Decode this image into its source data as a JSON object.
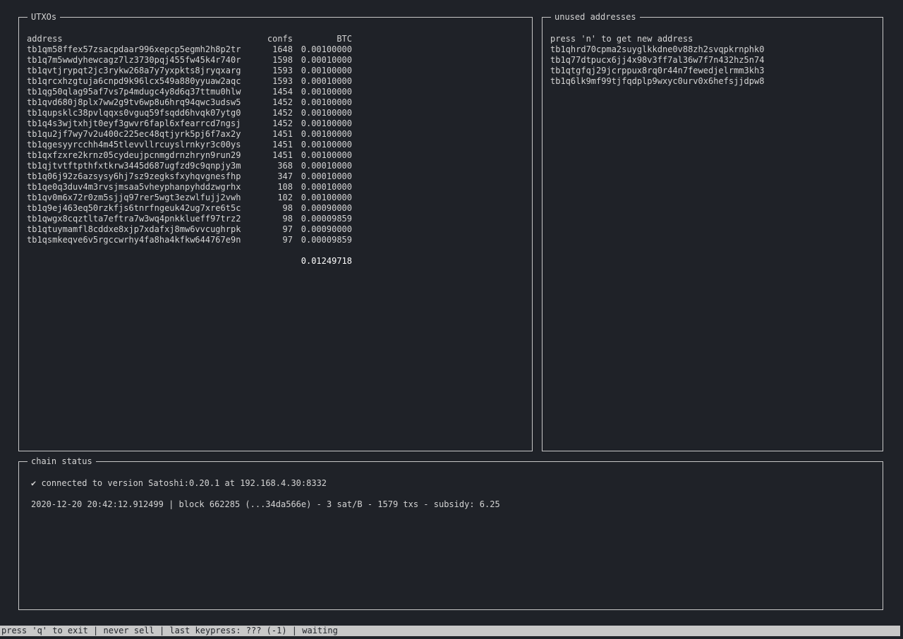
{
  "utxos": {
    "title": "UTXOs",
    "headers": {
      "address": "address",
      "confs": "confs",
      "btc": "BTC"
    },
    "rows": [
      {
        "address": "tb1qm58ffex57zsacpdaar996xepcp5egmh2h8p2tr",
        "confs": "1648",
        "btc": "0.00100000"
      },
      {
        "address": "tb1q7m5wwdyhewcagz7lz3730pqj455fw45k4r740r",
        "confs": "1598",
        "btc": "0.00010000"
      },
      {
        "address": "tb1qvtjrypqt2jc3rykw268a7y7yxpkts8jryqxarg",
        "confs": "1593",
        "btc": "0.00100000"
      },
      {
        "address": "tb1qrcxhzgtuja6cnpd9k96lcx549a880yyuaw2aqc",
        "confs": "1593",
        "btc": "0.00010000"
      },
      {
        "address": "tb1qg50qlag95af7vs7p4mdugc4y8d6q37ttmu0hlw",
        "confs": "1454",
        "btc": "0.00100000"
      },
      {
        "address": "tb1qvd680j8plx7ww2g9tv6wp8u6hrq94qwc3udsw5",
        "confs": "1452",
        "btc": "0.00100000"
      },
      {
        "address": "tb1qupsklc38pvlqqxs0vguq59fsqdd6hvqk07ytg0",
        "confs": "1452",
        "btc": "0.00100000"
      },
      {
        "address": "tb1q4s3wjtxhjt0eyf3gwvr6fapl6xfearrcd7ngsj",
        "confs": "1452",
        "btc": "0.00100000"
      },
      {
        "address": "tb1qu2jf7wy7v2u400c225ec48qtjyrk5pj6f7ax2y",
        "confs": "1451",
        "btc": "0.00100000"
      },
      {
        "address": "tb1qgesyyrcchh4m45tlevvllrcuyslrnkyr3c00ys",
        "confs": "1451",
        "btc": "0.00100000"
      },
      {
        "address": "tb1qxfzxre2krnz05cydeujpcnmgdrnzhryn9run29",
        "confs": "1451",
        "btc": "0.00100000"
      },
      {
        "address": "tb1qjtvtftpthfxtkrw3445d687ugfzd9c9qnpjy3m",
        "confs": "368",
        "btc": "0.00010000"
      },
      {
        "address": "tb1q06j92z6azsysy6hj7sz9zegksfxyhqvgnesfhp",
        "confs": "347",
        "btc": "0.00010000"
      },
      {
        "address": "tb1qe0q3duv4m3rvsjmsaa5vheyphanpyhddzwgrhx",
        "confs": "108",
        "btc": "0.00010000"
      },
      {
        "address": "tb1qv0m6x72r0zm5sjjq97rer5wgt3ezwlfujj2vwh",
        "confs": "102",
        "btc": "0.00100000"
      },
      {
        "address": "tb1q9ej463eq50rzkfjs6tnrfngeuk42ug7xre6t5c",
        "confs": "98",
        "btc": "0.00090000"
      },
      {
        "address": "tb1qwgx8cqztlta7eftra7w3wq4pnkklueff97trz2",
        "confs": "98",
        "btc": "0.00009859"
      },
      {
        "address": "tb1qtuymamfl8cddxe8xjp7xdafxj8mw6vvcughrpk",
        "confs": "97",
        "btc": "0.00090000"
      },
      {
        "address": "tb1qsmkeqve6v5rgccwrhy4fa8ha4kfkw644767e9n",
        "confs": "97",
        "btc": "0.00009859"
      }
    ],
    "total": "0.01249718"
  },
  "unused": {
    "title": "unused addresses",
    "hint": "press 'n' to get new address",
    "addresses": [
      "tb1qhrd70cpma2suyglkkdne0v88zh2svqpkrnphk0",
      "tb1q77dtpucx6jj4x98v3ff7al36w7f7n432hz5n74",
      "tb1qtgfqj29jcrppux8rq0r44n7fewedjelrmm3kh3",
      "tb1q6lk9mf99tjfqdplp9wxyc0urv0x6hefsjjdpw8"
    ]
  },
  "chain": {
    "title": "chain status",
    "connected": "✔ connected to version Satoshi:0.20.1 at 192.168.4.30:8332",
    "block_line": "2020-12-20 20:42:12.912499 | block 662285 (...34da566e) - 3 sat/B - 1579 txs - subsidy: 6.25"
  },
  "status_bar": {
    "text": "press 'q' to exit | never sell | last keypress: ??? (-1) | waiting"
  },
  "colors": {
    "background": "#1f2228",
    "foreground": "#d4d4d4",
    "border": "#c8c8c8",
    "status_bar_bg": "#c8c8c8"
  }
}
